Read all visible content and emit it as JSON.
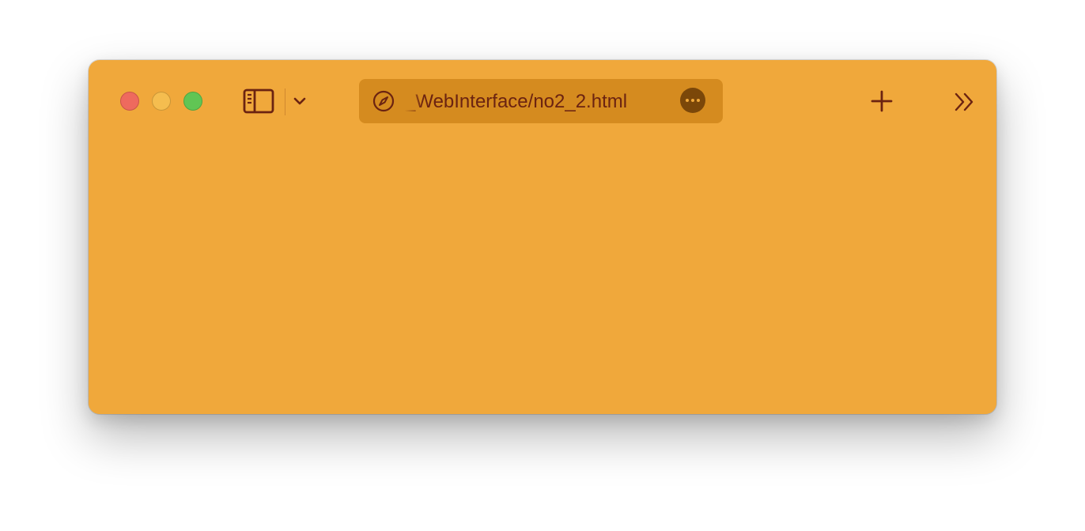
{
  "browser": {
    "address_bar": {
      "url_text": "_WebInterface/no2_2.html",
      "leading_icon": "compass-icon",
      "trailing_icon": "more-options-icon"
    },
    "toolbar": {
      "sidebar_icon": "sidebar-icon",
      "tab_menu_icon": "chevron-down-icon",
      "new_tab_icon": "plus-icon",
      "overflow_icon": "double-chevron-right-icon"
    },
    "traffic_lights": [
      "close",
      "minimize",
      "zoom"
    ]
  },
  "colors": {
    "window_background": "#f0a83b",
    "address_bar_background": "#d58b1f",
    "icon_color": "#6b2311",
    "close": "#ee6a5e",
    "minimize": "#f5bd4f",
    "zoom": "#61c554"
  }
}
